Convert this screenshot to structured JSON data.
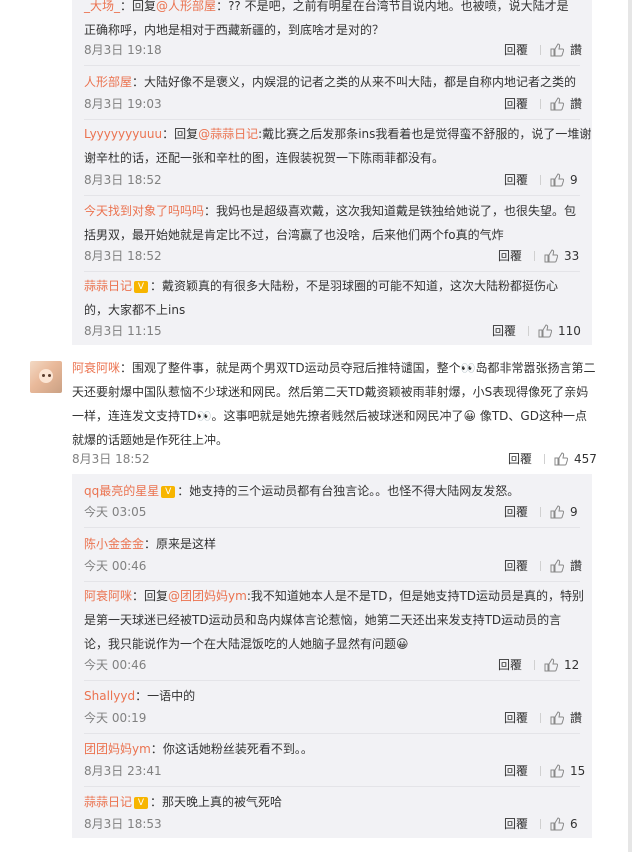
{
  "replies_a": [
    {
      "lines": [
        {
          "user": "_大场_",
          "sep": "：",
          "text": "回复",
          "ref": "@人形部屋",
          "rest": "：?? 不是吧，之前有明星在台湾节目说内地。也被喷，说大陆才是"
        },
        {
          "text": "正确称呼，内地是相对于西藏新疆的，到底啥才是对的？"
        }
      ],
      "time": "8月3日 19:18",
      "reply": "回覆",
      "like": "讚"
    },
    {
      "lines": [
        {
          "user": "人形部屋",
          "sep": "：",
          "text": "大陆好像不是褒义，内娱混的记者之类的从来不叫大陆，都是自称内地记者之类的"
        }
      ],
      "time": "8月3日 19:03",
      "reply": "回覆",
      "like": "讚"
    },
    {
      "lines": [
        {
          "user": "Lyyyyyyyuuu",
          "sep": "：",
          "text": "回复",
          "ref": "@蒜蒜日记",
          "rest": ":戴比赛之后发那条ins我看着也是觉得蛮不舒服的，说了一堆谢"
        },
        {
          "text": "谢辛杜的话，还配一张和辛杜的图，连假装祝贺一下陈雨菲都没有。"
        }
      ],
      "time": "8月3日 18:52",
      "reply": "回覆",
      "like": "9"
    },
    {
      "lines": [
        {
          "user": "今天找到对象了吗吗吗",
          "sep": "：",
          "text": "我妈也是超级喜欢戴，这次我知道戴是铁独给她说了，也很失望。包"
        },
        {
          "text": "括男双，最开始她就是肯定比不过，台湾赢了也没啥，后来他们两个fo真的气炸"
        }
      ],
      "time": "8月3日 18:52",
      "reply": "回覆",
      "like": "33"
    },
    {
      "lines": [
        {
          "user": "蒜蒜日记",
          "vip": true,
          "sep": "：",
          "text": "戴资颖真的有很多大陆粉，不是羽球圈的可能不知道，这次大陆粉都挺伤心"
        },
        {
          "text": "的，大家都不上ins"
        }
      ],
      "time": "8月3日 11:15",
      "reply": "回覆",
      "like": "110"
    }
  ],
  "main_comment": {
    "user": "阿衰阿咪",
    "lines": [
      "：围观了整件事，就是两个男双TD运动员夺冠后推特谴国，整个👀岛都非常嚣张扬言第二",
      "天还要射爆中国队惹恼不少球迷和网民。然后第二天TD戴资颖被雨菲射爆，小S表现得像死了亲妈",
      "一样，连连发文支持TD👀。这事吧就是她先撩者贱然后被球迷和网民冲了😀 像TD、GD这种一点",
      "就爆的话题她是作死往上冲。"
    ],
    "time": "8月3日 18:52",
    "reply": "回覆",
    "like": "457"
  },
  "replies_b": [
    {
      "lines": [
        {
          "user": "qq最亮的星星",
          "vip": true,
          "sep": "：",
          "text": "她支持的三个运动员都有台独言论。。也怪不得大陆网友发怒。"
        }
      ],
      "time": "今天 03:05",
      "reply": "回覆",
      "like": "9"
    },
    {
      "lines": [
        {
          "user": "陈小金金金",
          "sep": "：",
          "text": "原来是这样"
        }
      ],
      "time": "今天 00:46",
      "reply": "回覆",
      "like": "讚"
    },
    {
      "lines": [
        {
          "user": "阿衰阿咪",
          "sep": "：",
          "text": "回复",
          "ref": "@团团妈妈ym",
          "rest": ":我不知道她本人是不是TD，但是她支持TD运动员是真的，特别"
        },
        {
          "text": "是第一天球迷已经被TD运动员和岛内媒体言论惹恼，她第二天还出来发支持TD运动员的言"
        },
        {
          "text": "论，我只能说作为一个在大陆混饭吃的人她脑子显然有问题😀"
        }
      ],
      "time": "今天 00:46",
      "reply": "回覆",
      "like": "12"
    },
    {
      "lines": [
        {
          "user": "Shallyyd",
          "sep": "：",
          "text": "一语中的"
        }
      ],
      "time": "今天 00:19",
      "reply": "回覆",
      "like": "讚"
    },
    {
      "lines": [
        {
          "user": "团团妈妈ym",
          "sep": "：",
          "text": "你这话她粉丝装死看不到。。"
        }
      ],
      "time": "8月3日 23:41",
      "reply": "回覆",
      "like": "15"
    },
    {
      "lines": [
        {
          "user": "蒜蒜日记",
          "vip": true,
          "sep": "：",
          "text": "那天晚上真的被气死哈"
        }
      ],
      "time": "8月3日 18:53",
      "reply": "回覆",
      "like": "6"
    }
  ]
}
